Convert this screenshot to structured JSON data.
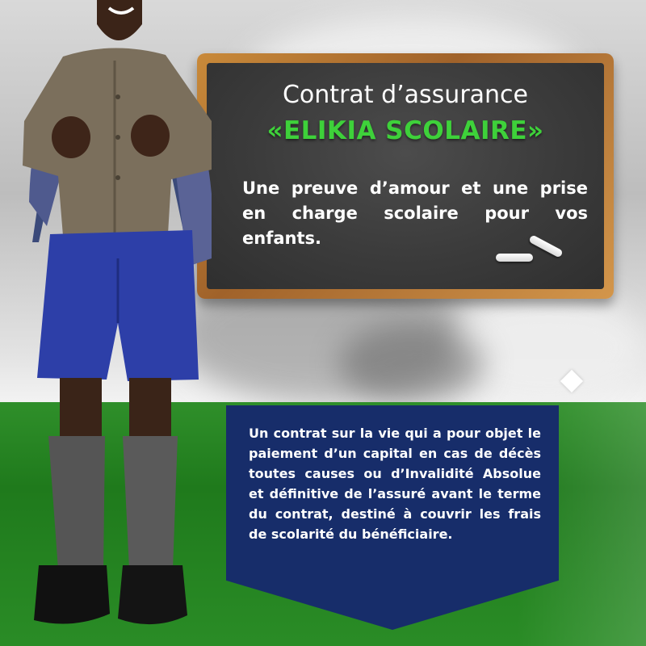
{
  "chalkboard": {
    "title": "Contrat d’assurance",
    "product_name": "«ELIKIA SCOLAIRE»",
    "tagline": "Une preuve d’amour et une prise en charge scolaire pour vos enfants."
  },
  "info_panel": {
    "text": "Un contrat sur la vie qui a pour objet le paiement d’un capital en cas de décès toutes causes ou d’Invalidité Absolue et définitive de l’assuré avant le terme du contrat, destiné à couvrir les frais de scolarité du bénéficiaire."
  },
  "colors": {
    "product_green": "#3ed13a",
    "panel_navy": "#172d6a",
    "band_green": "#2a8c26",
    "board_frame": "#b87832",
    "board_slate": "#3b3b3b"
  },
  "icons": {
    "chalk": "chalk-sticks",
    "diamond": "white-diamond"
  }
}
